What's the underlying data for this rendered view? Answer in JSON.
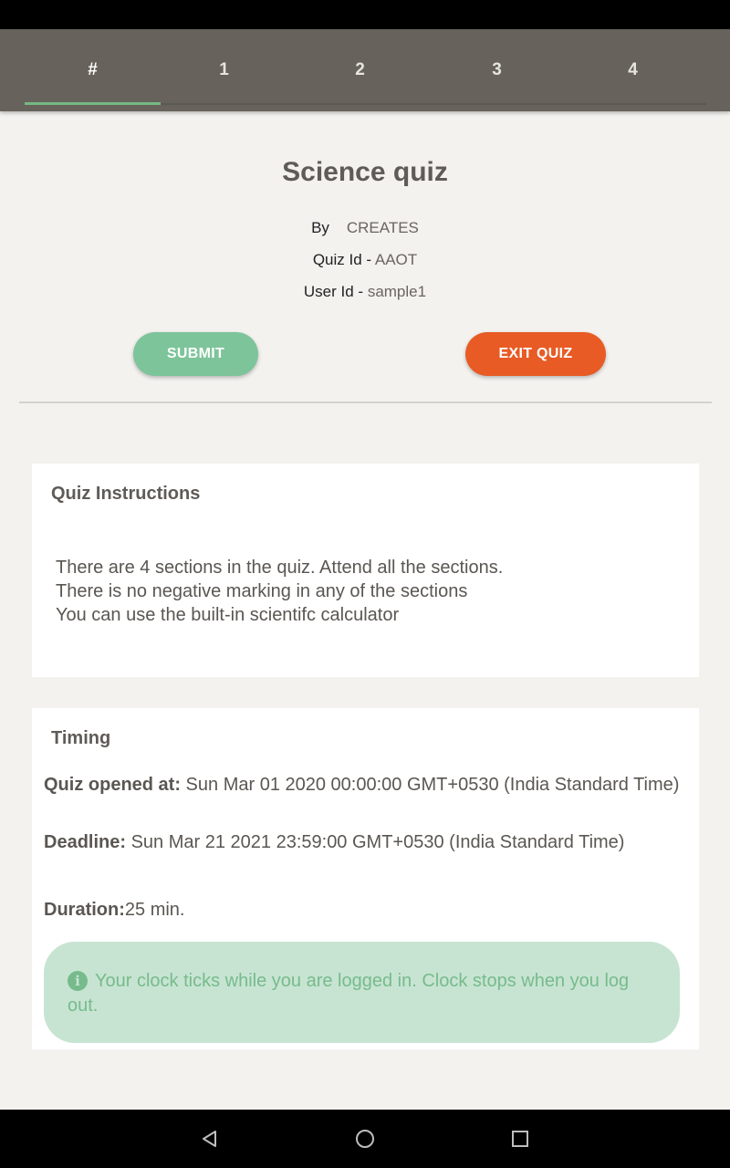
{
  "tabs": [
    {
      "label": "#",
      "active": true
    },
    {
      "label": "1",
      "active": false
    },
    {
      "label": "2",
      "active": false
    },
    {
      "label": "3",
      "active": false
    },
    {
      "label": "4",
      "active": false
    }
  ],
  "quiz": {
    "title": "Science quiz",
    "by_label": "By",
    "author": "CREATES",
    "quiz_id_label": "Quiz Id - ",
    "quiz_id": "AAOT",
    "user_id_label": "User Id - ",
    "user_id": "sample1"
  },
  "actions": {
    "submit_label": "SUBMIT",
    "exit_label": "EXIT QUIZ"
  },
  "instructions": {
    "title": "Quiz Instructions",
    "lines": [
      "There are 4 sections in the quiz. Attend all the sections.",
      "There is no negative marking in any of the sections",
      "You can use the built-in scientifc calculator"
    ]
  },
  "timing": {
    "title": "Timing",
    "opened_label": "Quiz opened at:",
    "opened_value": " Sun Mar 01 2020 00:00:00 GMT+0530 (India Standard Time)",
    "deadline_label": "Deadline:",
    "deadline_value": " Sun Mar 21 2021 23:59:00 GMT+0530 (India Standard Time)",
    "duration_label": "Duration:",
    "duration_value": "25 min.",
    "notice": "Your clock ticks while you are logged in. Clock stops when you log out."
  },
  "colors": {
    "tab_bar": "#67625c",
    "tab_indicator": "#76b982",
    "submit": "#7dc49a",
    "exit": "#e85b25",
    "alert_bg": "#c7e4d2",
    "alert_text": "#77bb8c"
  },
  "icons": {
    "info": "info-circle-icon",
    "nav_back": "triangle-back-icon",
    "nav_home": "circle-home-icon",
    "nav_recents": "square-recents-icon"
  }
}
